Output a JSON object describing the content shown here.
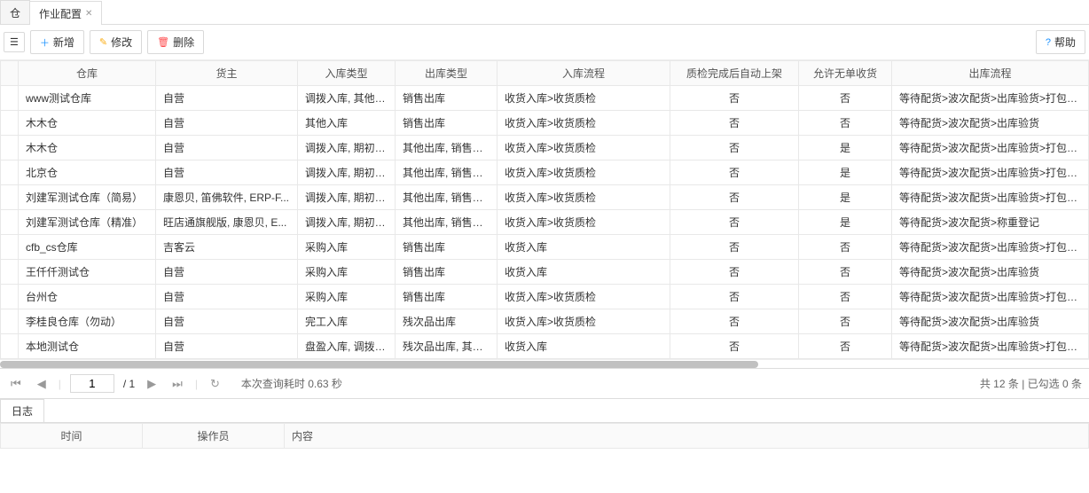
{
  "tabs": [
    {
      "label": "仓",
      "active": false
    },
    {
      "label": "作业配置",
      "active": true
    }
  ],
  "toolbar": {
    "hidden_btn": "",
    "add": "新增",
    "edit": "修改",
    "delete": "删除",
    "help": "帮助"
  },
  "columns": [
    "仓库",
    "货主",
    "入库类型",
    "出库类型",
    "入库流程",
    "质检完成后自动上架",
    "允许无单收货",
    "出库流程"
  ],
  "rows": [
    {
      "wh": "www测试仓库",
      "owner": "自营",
      "in_type": "调拨入库, 其他入库",
      "out_type": "销售出库",
      "in_flow": "收货入库>收货质检",
      "auto": "否",
      "allow": "否",
      "out_flow": "等待配货>波次配货>出库验货>打包登记"
    },
    {
      "wh": "木木仓",
      "owner": "自营",
      "in_type": "其他入库",
      "out_type": "销售出库",
      "in_flow": "收货入库>收货质检",
      "auto": "否",
      "allow": "否",
      "out_flow": "等待配货>波次配货>出库验货"
    },
    {
      "wh": "木木仓",
      "owner": "自营",
      "in_type": "调拨入库, 期初库...",
      "out_type": "其他出库, 销售出...",
      "in_flow": "收货入库>收货质检",
      "auto": "否",
      "allow": "是",
      "out_flow": "等待配货>波次配货>出库验货>打包登记"
    },
    {
      "wh": "北京仓",
      "owner": "自营",
      "in_type": "调拨入库, 期初库...",
      "out_type": "其他出库, 销售出...",
      "in_flow": "收货入库>收货质检",
      "auto": "否",
      "allow": "是",
      "out_flow": "等待配货>波次配货>出库验货>打包登记"
    },
    {
      "wh": "刘建军测试仓库（简易）",
      "owner": "康恩贝, 笛佛软件, ERP-F...",
      "in_type": "调拨入库, 期初库...",
      "out_type": "其他出库, 销售出...",
      "in_flow": "收货入库>收货质检",
      "auto": "否",
      "allow": "是",
      "out_flow": "等待配货>波次配货>出库验货>打包登记"
    },
    {
      "wh": "刘建军测试仓库（精准）",
      "owner": "旺店通旗舰版, 康恩贝, E...",
      "in_type": "调拨入库, 期初库...",
      "out_type": "其他出库, 销售出...",
      "in_flow": "收货入库>收货质检",
      "auto": "否",
      "allow": "是",
      "out_flow": "等待配货>波次配货>称重登记"
    },
    {
      "wh": "cfb_cs仓库",
      "owner": "吉客云",
      "in_type": "采购入库",
      "out_type": "销售出库",
      "in_flow": "收货入库",
      "auto": "否",
      "allow": "否",
      "out_flow": "等待配货>波次配货>出库验货>打包登记"
    },
    {
      "wh": "王仟仟测试仓",
      "owner": "自营",
      "in_type": "采购入库",
      "out_type": "销售出库",
      "in_flow": "收货入库",
      "auto": "否",
      "allow": "否",
      "out_flow": "等待配货>波次配货>出库验货"
    },
    {
      "wh": "台州仓",
      "owner": "自营",
      "in_type": "采购入库",
      "out_type": "销售出库",
      "in_flow": "收货入库>收货质检",
      "auto": "否",
      "allow": "否",
      "out_flow": "等待配货>波次配货>出库验货>打包登记"
    },
    {
      "wh": "李桂良仓库（勿动）",
      "owner": "自营",
      "in_type": "完工入库",
      "out_type": "残次品出库",
      "in_flow": "收货入库>收货质检",
      "auto": "否",
      "allow": "否",
      "out_flow": "等待配货>波次配货>出库验货"
    },
    {
      "wh": "本地测试仓",
      "owner": "自营",
      "in_type": "盘盈入库, 调拨入...",
      "out_type": "残次品出库, 其他...",
      "in_flow": "收货入库",
      "auto": "否",
      "allow": "否",
      "out_flow": "等待配货>波次配货>出库验货>打包登记"
    }
  ],
  "pager": {
    "page": "1",
    "total_pages": "/ 1",
    "query_time": "本次查询耗时 0.63 秒",
    "summary": "共 12 条 | 已勾选 0 条"
  },
  "log": {
    "tab": "日志",
    "columns": [
      "时间",
      "操作员",
      "内容"
    ]
  }
}
